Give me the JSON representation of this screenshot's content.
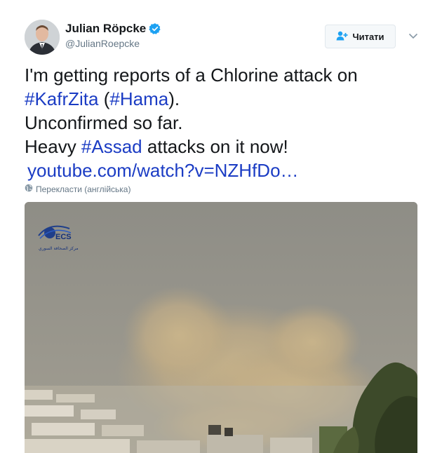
{
  "author": {
    "display_name": "Julian Röpcke",
    "handle": "@JulianRoepcke",
    "verified_icon": "verified-badge-icon"
  },
  "follow_button": {
    "label": "Читати",
    "icon": "add-user-icon"
  },
  "tweet": {
    "line1": "I'm getting reports of a Chlorine attack on",
    "line2_hashtag1": "#KafrZita",
    "line2_open_paren": " (",
    "line2_hashtag2": "#Hama",
    "line2_close": ").",
    "line3": "Unconfirmed so far.",
    "line4_prefix": "Heavy ",
    "line4_hashtag": "#Assad",
    "line4_suffix": " attacks on it now!",
    "url": "youtube.com/watch?v=NZHfDo…"
  },
  "translate": {
    "label": "Перекласти (англійська)",
    "icon": "globe-icon"
  },
  "media": {
    "watermark_text": "ECS",
    "watermark_caption": "مركز الصحافة السوري"
  },
  "colors": {
    "link": "#1b3cc4",
    "verified": "#1da1f2",
    "muted": "#657786"
  }
}
